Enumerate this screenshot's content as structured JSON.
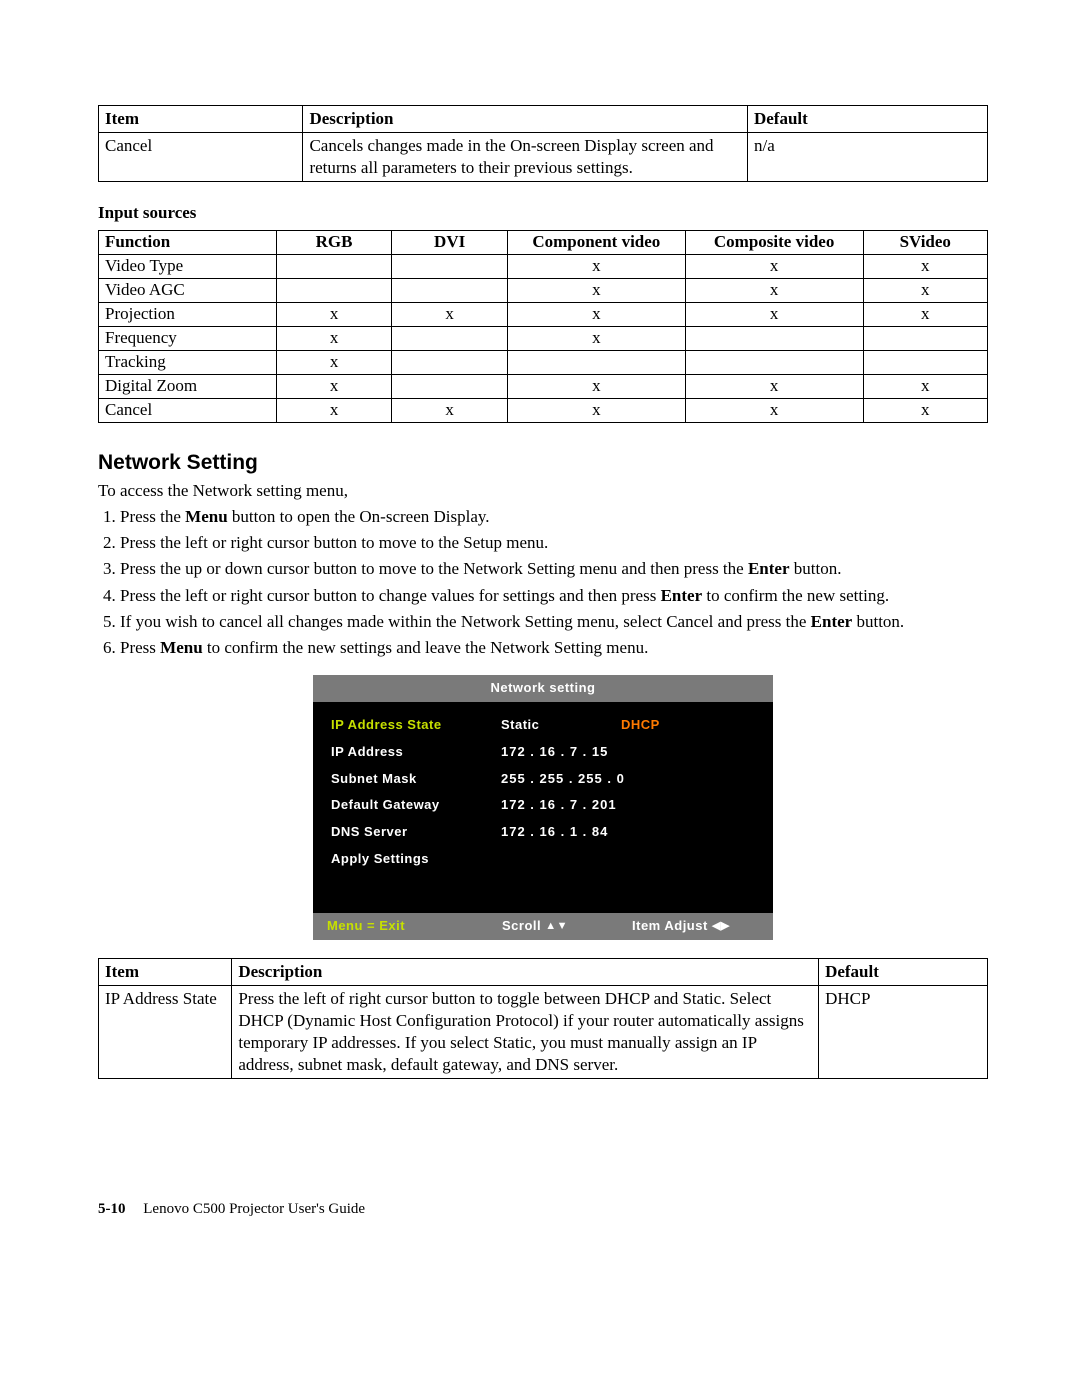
{
  "table1": {
    "headers": [
      "Item",
      "Description",
      "Default"
    ],
    "rows": [
      {
        "item": "Cancel",
        "desc": "Cancels changes made in the On-screen Display screen and returns all parameters to their previous settings.",
        "def": "n/a"
      }
    ]
  },
  "input_sources_label": "Input sources",
  "inputs_table": {
    "headers": [
      "Function",
      "RGB",
      "DVI",
      "Component video",
      "Composite video",
      "SVideo"
    ],
    "rows": [
      {
        "fn": "Video Type",
        "rgb": "",
        "dvi": "",
        "comp": "x",
        "cvid": "x",
        "svid": "x"
      },
      {
        "fn": "Video AGC",
        "rgb": "",
        "dvi": "",
        "comp": "x",
        "cvid": "x",
        "svid": "x"
      },
      {
        "fn": "Projection",
        "rgb": "x",
        "dvi": "x",
        "comp": "x",
        "cvid": "x",
        "svid": "x"
      },
      {
        "fn": "Frequency",
        "rgb": "x",
        "dvi": "",
        "comp": "x",
        "cvid": "",
        "svid": ""
      },
      {
        "fn": "Tracking",
        "rgb": "x",
        "dvi": "",
        "comp": "",
        "cvid": "",
        "svid": ""
      },
      {
        "fn": "Digital Zoom",
        "rgb": "x",
        "dvi": "",
        "comp": "x",
        "cvid": "x",
        "svid": "x"
      },
      {
        "fn": "Cancel",
        "rgb": "x",
        "dvi": "x",
        "comp": "x",
        "cvid": "x",
        "svid": "x"
      }
    ]
  },
  "section_heading": "Network Setting",
  "intro_text": "To access the Network setting menu,",
  "steps": {
    "s1a": "Press the ",
    "s1b": "Menu",
    "s1c": " button to open the On-screen Display.",
    "s2": "Press the left or right cursor button to move to the Setup menu.",
    "s3a": "Press the up or down cursor button to move to the Network Setting menu and then press the ",
    "s3b": "Enter",
    "s3c": " button.",
    "s4a": "Press the left or right cursor button to change values for settings and then press ",
    "s4b": "Enter",
    "s4c": " to confirm the new setting.",
    "s5a": "If you wish to cancel all changes made within the Network Setting menu, select Cancel and press the ",
    "s5b": "Enter",
    "s5c": " button.",
    "s6a": "Press ",
    "s6b": "Menu",
    "s6c": " to confirm the new settings and leave the Network Setting menu."
  },
  "osd": {
    "title": "Network setting",
    "rows": [
      {
        "label": "IP Address State",
        "value_left": "Static",
        "value_right": "DHCP",
        "current": true
      },
      {
        "label": "IP Address",
        "value": "172 .   16 .     7 .    15"
      },
      {
        "label": "Subnet Mask",
        "value": "255 . 255 . 255 .     0"
      },
      {
        "label": "Default Gateway",
        "value": "172 .   16 .     7 .  201"
      },
      {
        "label": "DNS Server",
        "value": "172 .   16 .     1 .    84"
      },
      {
        "label": "Apply Settings",
        "value": ""
      }
    ],
    "footer": {
      "left": "Menu = Exit",
      "mid": "Scroll",
      "right": "Item Adjust"
    }
  },
  "net_table": {
    "headers": [
      "Item",
      "Description",
      "Default"
    ],
    "rows": [
      {
        "item": "IP Address State",
        "desc": "Press the left of right cursor button to toggle between DHCP and Static. Select DHCP (Dynamic Host Configuration Protocol) if your router automatically assigns temporary IP addresses. If you select Static, you must manually assign an IP address, subnet mask, default gateway, and DNS server.",
        "def": "DHCP"
      }
    ]
  },
  "footer": {
    "pagenum": "5-10",
    "title": "Lenovo C500 Projector User's Guide"
  }
}
